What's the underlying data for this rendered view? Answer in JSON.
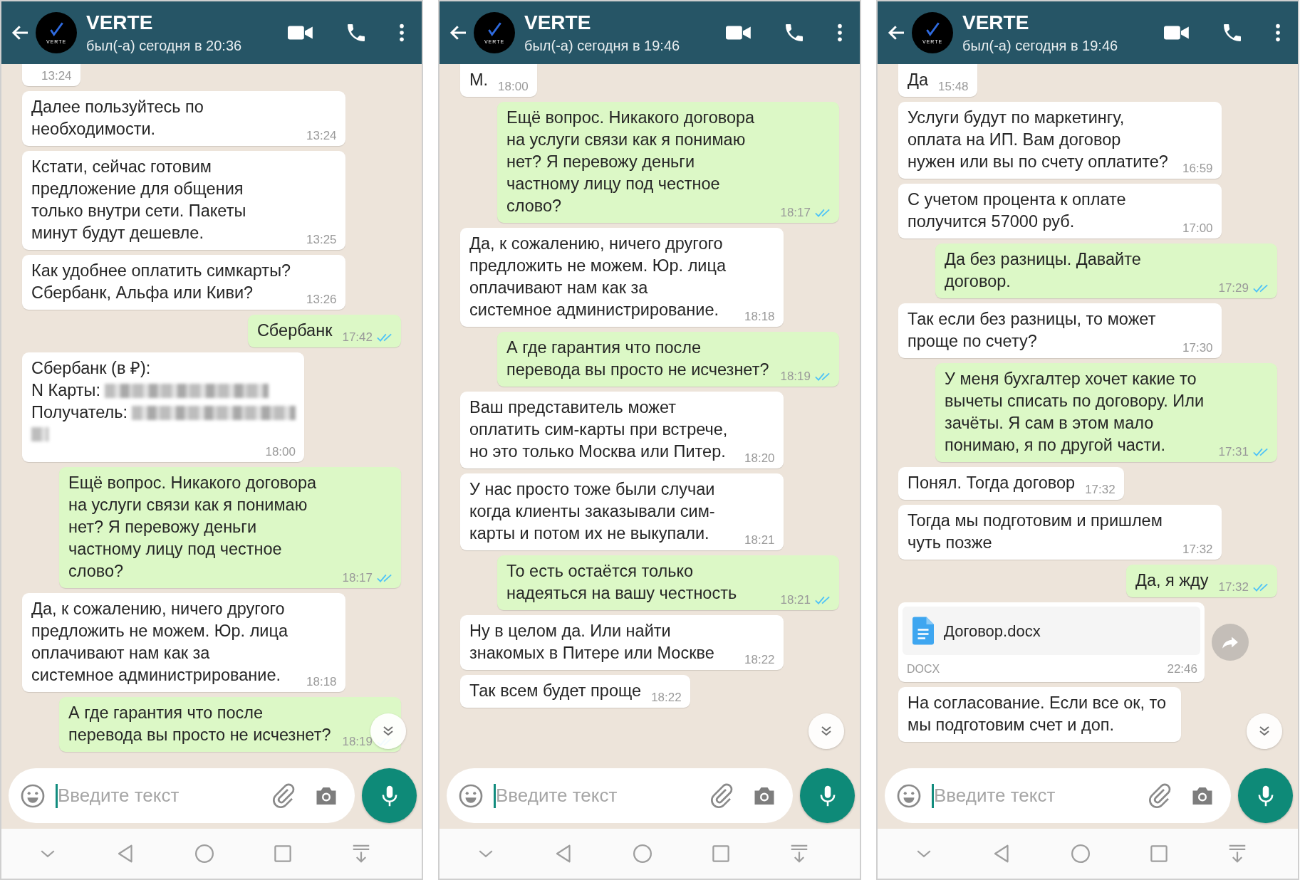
{
  "panels": [
    {
      "header": {
        "avatar_label": "VERTE",
        "title": "VERTE",
        "status": "был(-а) сегодня в 20:36"
      },
      "messages": [
        {
          "outgoing": false,
          "kind": "text",
          "time": "13:24"
        },
        {
          "outgoing": false,
          "kind": "text",
          "text": "Далее пользуйтесь по необходимости.",
          "time": "13:24"
        },
        {
          "outgoing": false,
          "kind": "text",
          "text": "Кстати, сейчас готовим предложение для общения только внутри сети. Пакеты минут будут дешевле.",
          "time": "13:25"
        },
        {
          "outgoing": false,
          "kind": "text",
          "text": "Как удобнее оплатить симкарты? Сбербанк, Альфа или Киви?",
          "time": "13:26"
        },
        {
          "outgoing": true,
          "kind": "text",
          "text": "Сбербанк",
          "time": "17:42",
          "read": true
        },
        {
          "outgoing": false,
          "kind": "card",
          "lines": [
            {
              "text": "Сбербанк (в ₽):",
              "redacted": false
            },
            {
              "text": "N Карты:",
              "redacted": true
            },
            {
              "text": "Получатель:",
              "redacted": true
            },
            {
              "redacted": true
            }
          ],
          "time": "18:00"
        },
        {
          "outgoing": true,
          "kind": "text",
          "text": "Ещё вопрос. Никакого договора на услуги связи как я понимаю нет? Я перевожу деньги частному лицу под честное слово?",
          "time": "18:17",
          "read": true
        },
        {
          "outgoing": false,
          "kind": "text",
          "text": "Да, к сожалению, ничего другого предложить не можем. Юр. лица оплачивают нам как за системное администрирование.",
          "time": "18:18"
        },
        {
          "outgoing": true,
          "kind": "text",
          "text": "А где гарантия что после перевода вы просто не исчезнет?",
          "time": "18:19",
          "read": true
        }
      ],
      "composer": {
        "placeholder": "Введите текст"
      }
    },
    {
      "header": {
        "avatar_label": "VERTE",
        "title": "VERTE",
        "status": "был(-а) сегодня в 19:46"
      },
      "messages": [
        {
          "outgoing": false,
          "kind": "text",
          "text": "М.",
          "time": "18:00"
        },
        {
          "outgoing": true,
          "kind": "text",
          "text": "Ещё вопрос. Никакого договора на услуги связи как я понимаю нет? Я перевожу деньги частному лицу под честное слово?",
          "time": "18:17",
          "read": true
        },
        {
          "outgoing": false,
          "kind": "text",
          "text": "Да, к сожалению, ничего другого предложить не можем. Юр. лица оплачивают нам как за системное администрирование.",
          "time": "18:18"
        },
        {
          "outgoing": true,
          "kind": "text",
          "text": "А где гарантия что после перевода вы просто не исчезнет?",
          "time": "18:19",
          "read": true
        },
        {
          "outgoing": false,
          "kind": "text",
          "text": "Ваш представитель может оплатить сим-карты при встрече, но это только Москва или Питер.",
          "time": "18:20"
        },
        {
          "outgoing": false,
          "kind": "text",
          "text": "У нас просто тоже были случаи когда клиенты заказывали сим-карты и потом их не выкупали.",
          "time": "18:21"
        },
        {
          "outgoing": true,
          "kind": "text",
          "text": "То есть остаётся только надеяться на вашу честность",
          "time": "18:21",
          "read": true
        },
        {
          "outgoing": false,
          "kind": "text",
          "text": "Ну в целом да. Или найти знакомых в Питере или Москве",
          "time": "18:22"
        },
        {
          "outgoing": false,
          "kind": "text",
          "text": "Так всем будет проще",
          "time": "18:22"
        }
      ],
      "composer": {
        "placeholder": "Введите текст"
      }
    },
    {
      "header": {
        "avatar_label": "VERTE",
        "title": "VERTE",
        "status": "был(-а) сегодня в 19:46"
      },
      "messages": [
        {
          "outgoing": false,
          "kind": "text",
          "text": "Да",
          "time": "15:48"
        },
        {
          "outgoing": false,
          "kind": "text",
          "text": "Услуги будут по маркетингу, оплата на ИП. Вам договор нужен или вы по счету оплатите?",
          "time": "16:59"
        },
        {
          "outgoing": false,
          "kind": "text",
          "text": "С учетом процента к оплате получится 57000 руб.",
          "time": "17:00"
        },
        {
          "outgoing": true,
          "kind": "text",
          "text": "Да без разницы. Давайте договор.",
          "time": "17:29",
          "read": true
        },
        {
          "outgoing": false,
          "kind": "text",
          "text": "Так если без разницы, то может проще по счету?",
          "time": "17:30"
        },
        {
          "outgoing": true,
          "kind": "text",
          "text": "У меня бухгалтер хочет какие то вычеты списать по договору. Или зачёты. Я сам в этом мало понимаю, я по другой части.",
          "time": "17:31",
          "read": true
        },
        {
          "outgoing": false,
          "kind": "text",
          "text": "Понял. Тогда договор",
          "time": "17:32"
        },
        {
          "outgoing": false,
          "kind": "text",
          "text": "Тогда мы подготовим и пришлем чуть позже",
          "time": "17:32"
        },
        {
          "outgoing": true,
          "kind": "text",
          "text": "Да, я жду",
          "time": "17:32",
          "read": true
        },
        {
          "outgoing": false,
          "kind": "document",
          "file_name": "Договор.docx",
          "file_type": "DOCX",
          "time": "22:46",
          "forward": true
        },
        {
          "outgoing": false,
          "kind": "text",
          "text": "На согласование. Если все ок, то мы подготовим счет и доп."
        }
      ],
      "composer": {
        "placeholder": "Введите текст"
      }
    }
  ]
}
